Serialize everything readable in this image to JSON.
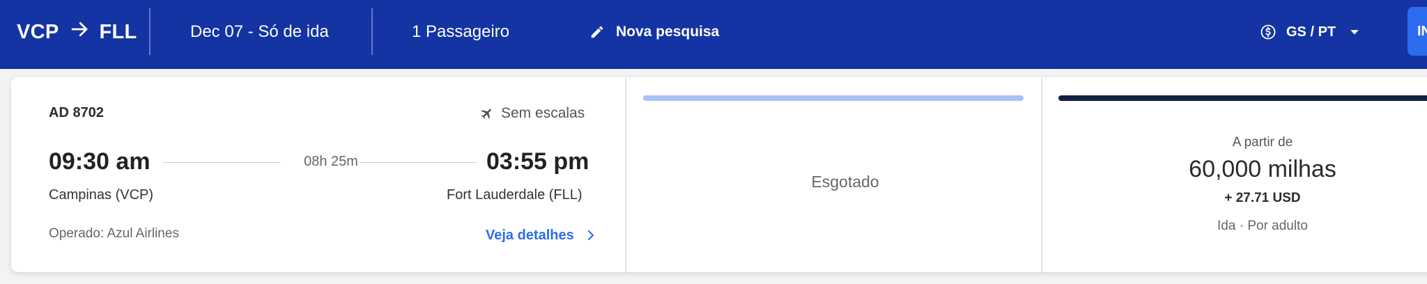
{
  "header": {
    "origin": "VCP",
    "destination": "FLL",
    "date": "Dec 07 - Só de ida",
    "passengers": "1 Passageiro",
    "new_search": "Nova pesquisa",
    "locale": "GS / PT",
    "login_label": "IN"
  },
  "flight": {
    "number": "AD 8702",
    "stops": "Sem escalas",
    "departure_time": "09:30 am",
    "arrival_time": "03:55 pm",
    "duration": "08h 25m",
    "departure_city": "Campinas (VCP)",
    "arrival_city": "Fort Lauderdale (FLL)",
    "operated_by": "Operado: Azul Airlines",
    "details_link": "Veja detalhes"
  },
  "fares": {
    "option1": {
      "status": "Esgotado",
      "bar_color": "#a9c1f5"
    },
    "option2": {
      "from_label": "A partir de",
      "miles": "60,000 milhas",
      "tax": "+ 27.71 USD",
      "note": "Ida · Por adulto",
      "bar_color": "#0f1f44"
    }
  },
  "colors": {
    "header_bg": "#1434a4",
    "accent": "#2b6cf0"
  }
}
